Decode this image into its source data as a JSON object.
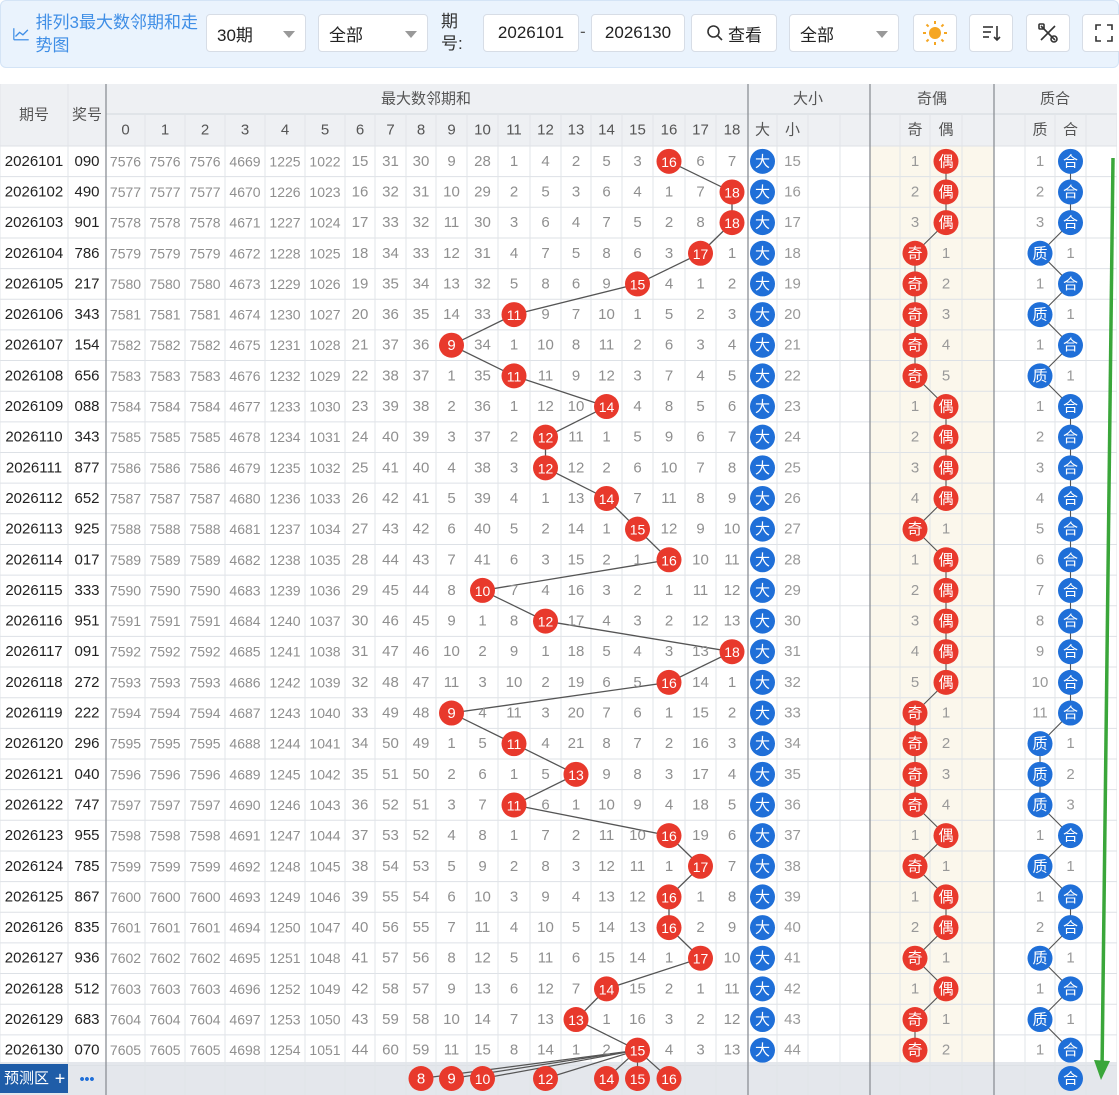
{
  "toolbar": {
    "title": "排列3最大数邻期和走势图",
    "period_select": "30期",
    "filter_select": "全部",
    "issue_label": "期号:",
    "issue_start": "2026101",
    "issue_sep": "-",
    "issue_end": "2026130",
    "query_label": "查看",
    "filter2_select": "全部",
    "icons": [
      "chart-line-icon",
      "search-icon",
      "sun-icon",
      "sort-icon",
      "tools-icon",
      "fullscreen-icon"
    ]
  },
  "headers": {
    "issue": "期号",
    "prize": "奖号",
    "main_group": "最大数邻期和",
    "size_group": "大小",
    "parity_group": "奇偶",
    "prime_group": "质合",
    "cols": [
      "0",
      "1",
      "2",
      "3",
      "4",
      "5",
      "6",
      "7",
      "8",
      "9",
      "10",
      "11",
      "12",
      "13",
      "14",
      "15",
      "16",
      "17",
      "18"
    ],
    "size_cols": [
      "大",
      "小"
    ],
    "parity_cols": [
      "奇",
      "偶"
    ],
    "prime_cols": [
      "质",
      "合"
    ]
  },
  "labels": {
    "big": "大",
    "small": "小",
    "odd": "奇",
    "even": "偶",
    "prime": "质",
    "composite": "合"
  },
  "colors": {
    "red": "#e8392c",
    "blue": "#1f6fd8",
    "line": "#555555",
    "arrow": "#3aa63a",
    "highlight": "#fbf7ec"
  },
  "rows": [
    {
      "issue": "2026101",
      "prize": "090",
      "cells": [
        "7576",
        "7576",
        "7576",
        "4669",
        "1225",
        "1022",
        "15",
        "31",
        "30",
        "9",
        "28",
        "1",
        "4",
        "2",
        "5",
        "3",
        "16",
        "6",
        "7"
      ],
      "hit": 16,
      "size": "big",
      "size_other": "15",
      "parity": "even",
      "parity_other": "1",
      "prime": "composite",
      "prime_other": "1"
    },
    {
      "issue": "2026102",
      "prize": "490",
      "cells": [
        "7577",
        "7577",
        "7577",
        "4670",
        "1226",
        "1023",
        "16",
        "32",
        "31",
        "10",
        "29",
        "2",
        "5",
        "3",
        "6",
        "4",
        "1",
        "7",
        "18"
      ],
      "hit": 18,
      "size": "big",
      "size_other": "16",
      "parity": "even",
      "parity_other": "2",
      "prime": "composite",
      "prime_other": "2"
    },
    {
      "issue": "2026103",
      "prize": "901",
      "cells": [
        "7578",
        "7578",
        "7578",
        "4671",
        "1227",
        "1024",
        "17",
        "33",
        "32",
        "11",
        "30",
        "3",
        "6",
        "4",
        "7",
        "5",
        "2",
        "8",
        "18"
      ],
      "hit": 18,
      "size": "big",
      "size_other": "17",
      "parity": "even",
      "parity_other": "3",
      "prime": "composite",
      "prime_other": "3"
    },
    {
      "issue": "2026104",
      "prize": "786",
      "cells": [
        "7579",
        "7579",
        "7579",
        "4672",
        "1228",
        "1025",
        "18",
        "34",
        "33",
        "12",
        "31",
        "4",
        "7",
        "5",
        "8",
        "6",
        "3",
        "17",
        "1"
      ],
      "hit": 17,
      "size": "big",
      "size_other": "18",
      "parity": "odd",
      "parity_other": "1",
      "prime": "prime",
      "prime_other": "1"
    },
    {
      "issue": "2026105",
      "prize": "217",
      "cells": [
        "7580",
        "7580",
        "7580",
        "4673",
        "1229",
        "1026",
        "19",
        "35",
        "34",
        "13",
        "32",
        "5",
        "8",
        "6",
        "9",
        "15",
        "4",
        "1",
        "2"
      ],
      "hit": 15,
      "size": "big",
      "size_other": "19",
      "parity": "odd",
      "parity_other": "2",
      "prime": "composite",
      "prime_other": "1"
    },
    {
      "issue": "2026106",
      "prize": "343",
      "cells": [
        "7581",
        "7581",
        "7581",
        "4674",
        "1230",
        "1027",
        "20",
        "36",
        "35",
        "14",
        "33",
        "11",
        "9",
        "7",
        "10",
        "1",
        "5",
        "2",
        "3"
      ],
      "hit": 11,
      "size": "big",
      "size_other": "20",
      "parity": "odd",
      "parity_other": "3",
      "prime": "prime",
      "prime_other": "1"
    },
    {
      "issue": "2026107",
      "prize": "154",
      "cells": [
        "7582",
        "7582",
        "7582",
        "4675",
        "1231",
        "1028",
        "21",
        "37",
        "36",
        "9",
        "34",
        "1",
        "10",
        "8",
        "11",
        "2",
        "6",
        "3",
        "4"
      ],
      "hit": 9,
      "size": "big",
      "size_other": "21",
      "parity": "odd",
      "parity_other": "4",
      "prime": "composite",
      "prime_other": "1"
    },
    {
      "issue": "2026108",
      "prize": "656",
      "cells": [
        "7583",
        "7583",
        "7583",
        "4676",
        "1232",
        "1029",
        "22",
        "38",
        "37",
        "1",
        "35",
        "11",
        "11",
        "9",
        "12",
        "3",
        "7",
        "4",
        "5"
      ],
      "hit": 11,
      "size": "big",
      "size_other": "22",
      "parity": "odd",
      "parity_other": "5",
      "prime": "prime",
      "prime_other": "1"
    },
    {
      "issue": "2026109",
      "prize": "088",
      "cells": [
        "7584",
        "7584",
        "7584",
        "4677",
        "1233",
        "1030",
        "23",
        "39",
        "38",
        "2",
        "36",
        "1",
        "12",
        "10",
        "14",
        "4",
        "8",
        "5",
        "6"
      ],
      "hit": 14,
      "size": "big",
      "size_other": "23",
      "parity": "even",
      "parity_other": "1",
      "prime": "composite",
      "prime_other": "1"
    },
    {
      "issue": "2026110",
      "prize": "343",
      "cells": [
        "7585",
        "7585",
        "7585",
        "4678",
        "1234",
        "1031",
        "24",
        "40",
        "39",
        "3",
        "37",
        "2",
        "12",
        "11",
        "1",
        "5",
        "9",
        "6",
        "7"
      ],
      "hit": 12,
      "size": "big",
      "size_other": "24",
      "parity": "even",
      "parity_other": "2",
      "prime": "composite",
      "prime_other": "2"
    },
    {
      "issue": "2026111",
      "prize": "877",
      "cells": [
        "7586",
        "7586",
        "7586",
        "4679",
        "1235",
        "1032",
        "25",
        "41",
        "40",
        "4",
        "38",
        "3",
        "12",
        "12",
        "2",
        "6",
        "10",
        "7",
        "8"
      ],
      "hit": 12,
      "size": "big",
      "size_other": "25",
      "parity": "even",
      "parity_other": "3",
      "prime": "composite",
      "prime_other": "3"
    },
    {
      "issue": "2026112",
      "prize": "652",
      "cells": [
        "7587",
        "7587",
        "7587",
        "4680",
        "1236",
        "1033",
        "26",
        "42",
        "41",
        "5",
        "39",
        "4",
        "1",
        "13",
        "14",
        "7",
        "11",
        "8",
        "9"
      ],
      "hit": 14,
      "size": "big",
      "size_other": "26",
      "parity": "even",
      "parity_other": "4",
      "prime": "composite",
      "prime_other": "4"
    },
    {
      "issue": "2026113",
      "prize": "925",
      "cells": [
        "7588",
        "7588",
        "7588",
        "4681",
        "1237",
        "1034",
        "27",
        "43",
        "42",
        "6",
        "40",
        "5",
        "2",
        "14",
        "1",
        "15",
        "12",
        "9",
        "10"
      ],
      "hit": 15,
      "size": "big",
      "size_other": "27",
      "parity": "odd",
      "parity_other": "1",
      "prime": "composite",
      "prime_other": "5"
    },
    {
      "issue": "2026114",
      "prize": "017",
      "cells": [
        "7589",
        "7589",
        "7589",
        "4682",
        "1238",
        "1035",
        "28",
        "44",
        "43",
        "7",
        "41",
        "6",
        "3",
        "15",
        "2",
        "1",
        "16",
        "10",
        "11"
      ],
      "hit": 16,
      "size": "big",
      "size_other": "28",
      "parity": "even",
      "parity_other": "1",
      "prime": "composite",
      "prime_other": "6"
    },
    {
      "issue": "2026115",
      "prize": "333",
      "cells": [
        "7590",
        "7590",
        "7590",
        "4683",
        "1239",
        "1036",
        "29",
        "45",
        "44",
        "8",
        "10",
        "7",
        "4",
        "16",
        "3",
        "2",
        "1",
        "11",
        "12"
      ],
      "hit": 10,
      "size": "big",
      "size_other": "29",
      "parity": "even",
      "parity_other": "2",
      "prime": "composite",
      "prime_other": "7"
    },
    {
      "issue": "2026116",
      "prize": "951",
      "cells": [
        "7591",
        "7591",
        "7591",
        "4684",
        "1240",
        "1037",
        "30",
        "46",
        "45",
        "9",
        "1",
        "8",
        "12",
        "17",
        "4",
        "3",
        "2",
        "12",
        "13"
      ],
      "hit": 12,
      "size": "big",
      "size_other": "30",
      "parity": "even",
      "parity_other": "3",
      "prime": "composite",
      "prime_other": "8"
    },
    {
      "issue": "2026117",
      "prize": "091",
      "cells": [
        "7592",
        "7592",
        "7592",
        "4685",
        "1241",
        "1038",
        "31",
        "47",
        "46",
        "10",
        "2",
        "9",
        "1",
        "18",
        "5",
        "4",
        "3",
        "13",
        "18"
      ],
      "hit": 18,
      "size": "big",
      "size_other": "31",
      "parity": "even",
      "parity_other": "4",
      "prime": "composite",
      "prime_other": "9"
    },
    {
      "issue": "2026118",
      "prize": "272",
      "cells": [
        "7593",
        "7593",
        "7593",
        "4686",
        "1242",
        "1039",
        "32",
        "48",
        "47",
        "11",
        "3",
        "10",
        "2",
        "19",
        "6",
        "5",
        "16",
        "14",
        "1"
      ],
      "hit": 16,
      "size": "big",
      "size_other": "32",
      "parity": "even",
      "parity_other": "5",
      "prime": "composite",
      "prime_other": "10"
    },
    {
      "issue": "2026119",
      "prize": "222",
      "cells": [
        "7594",
        "7594",
        "7594",
        "4687",
        "1243",
        "1040",
        "33",
        "49",
        "48",
        "9",
        "4",
        "11",
        "3",
        "20",
        "7",
        "6",
        "1",
        "15",
        "2"
      ],
      "hit": 9,
      "size": "big",
      "size_other": "33",
      "parity": "odd",
      "parity_other": "1",
      "prime": "composite",
      "prime_other": "11"
    },
    {
      "issue": "2026120",
      "prize": "296",
      "cells": [
        "7595",
        "7595",
        "7595",
        "4688",
        "1244",
        "1041",
        "34",
        "50",
        "49",
        "1",
        "5",
        "11",
        "4",
        "21",
        "8",
        "7",
        "2",
        "16",
        "3"
      ],
      "hit": 11,
      "size": "big",
      "size_other": "34",
      "parity": "odd",
      "parity_other": "2",
      "prime": "prime",
      "prime_other": "1"
    },
    {
      "issue": "2026121",
      "prize": "040",
      "cells": [
        "7596",
        "7596",
        "7596",
        "4689",
        "1245",
        "1042",
        "35",
        "51",
        "50",
        "2",
        "6",
        "1",
        "5",
        "13",
        "9",
        "8",
        "3",
        "17",
        "4"
      ],
      "hit": 13,
      "size": "big",
      "size_other": "35",
      "parity": "odd",
      "parity_other": "3",
      "prime": "prime",
      "prime_other": "2"
    },
    {
      "issue": "2026122",
      "prize": "747",
      "cells": [
        "7597",
        "7597",
        "7597",
        "4690",
        "1246",
        "1043",
        "36",
        "52",
        "51",
        "3",
        "7",
        "11",
        "6",
        "1",
        "10",
        "9",
        "4",
        "18",
        "5"
      ],
      "hit": 11,
      "size": "big",
      "size_other": "36",
      "parity": "odd",
      "parity_other": "4",
      "prime": "prime",
      "prime_other": "3"
    },
    {
      "issue": "2026123",
      "prize": "955",
      "cells": [
        "7598",
        "7598",
        "7598",
        "4691",
        "1247",
        "1044",
        "37",
        "53",
        "52",
        "4",
        "8",
        "1",
        "7",
        "2",
        "11",
        "10",
        "16",
        "19",
        "6"
      ],
      "hit": 16,
      "size": "big",
      "size_other": "37",
      "parity": "even",
      "parity_other": "1",
      "prime": "composite",
      "prime_other": "1"
    },
    {
      "issue": "2026124",
      "prize": "785",
      "cells": [
        "7599",
        "7599",
        "7599",
        "4692",
        "1248",
        "1045",
        "38",
        "54",
        "53",
        "5",
        "9",
        "2",
        "8",
        "3",
        "12",
        "11",
        "1",
        "17",
        "7"
      ],
      "hit": 17,
      "size": "big",
      "size_other": "38",
      "parity": "odd",
      "parity_other": "1",
      "prime": "prime",
      "prime_other": "1"
    },
    {
      "issue": "2026125",
      "prize": "867",
      "cells": [
        "7600",
        "7600",
        "7600",
        "4693",
        "1249",
        "1046",
        "39",
        "55",
        "54",
        "6",
        "10",
        "3",
        "9",
        "4",
        "13",
        "12",
        "16",
        "1",
        "8"
      ],
      "hit": 16,
      "size": "big",
      "size_other": "39",
      "parity": "even",
      "parity_other": "1",
      "prime": "composite",
      "prime_other": "1"
    },
    {
      "issue": "2026126",
      "prize": "835",
      "cells": [
        "7601",
        "7601",
        "7601",
        "4694",
        "1250",
        "1047",
        "40",
        "56",
        "55",
        "7",
        "11",
        "4",
        "10",
        "5",
        "14",
        "13",
        "16",
        "2",
        "9"
      ],
      "hit": 16,
      "size": "big",
      "size_other": "40",
      "parity": "even",
      "parity_other": "2",
      "prime": "composite",
      "prime_other": "2"
    },
    {
      "issue": "2026127",
      "prize": "936",
      "cells": [
        "7602",
        "7602",
        "7602",
        "4695",
        "1251",
        "1048",
        "41",
        "57",
        "56",
        "8",
        "12",
        "5",
        "11",
        "6",
        "15",
        "14",
        "1",
        "17",
        "10"
      ],
      "hit": 17,
      "size": "big",
      "size_other": "41",
      "parity": "odd",
      "parity_other": "1",
      "prime": "prime",
      "prime_other": "1"
    },
    {
      "issue": "2026128",
      "prize": "512",
      "cells": [
        "7603",
        "7603",
        "7603",
        "4696",
        "1252",
        "1049",
        "42",
        "58",
        "57",
        "9",
        "13",
        "6",
        "12",
        "7",
        "14",
        "15",
        "2",
        "1",
        "11"
      ],
      "hit": 14,
      "size": "big",
      "size_other": "42",
      "parity": "even",
      "parity_other": "1",
      "prime": "composite",
      "prime_other": "1"
    },
    {
      "issue": "2026129",
      "prize": "683",
      "cells": [
        "7604",
        "7604",
        "7604",
        "4697",
        "1253",
        "1050",
        "43",
        "59",
        "58",
        "10",
        "14",
        "7",
        "13",
        "13",
        "1",
        "16",
        "3",
        "2",
        "12"
      ],
      "hit": 13,
      "size": "big",
      "size_other": "43",
      "parity": "odd",
      "parity_other": "1",
      "prime": "prime",
      "prime_other": "1"
    },
    {
      "issue": "2026130",
      "prize": "070",
      "cells": [
        "7605",
        "7605",
        "7605",
        "4698",
        "1254",
        "1051",
        "44",
        "60",
        "59",
        "11",
        "15",
        "8",
        "14",
        "1",
        "2",
        "15",
        "4",
        "3",
        "13"
      ],
      "hit": 15,
      "size": "big",
      "size_other": "44",
      "parity": "odd",
      "parity_other": "2",
      "prime": "composite",
      "prime_other": "1"
    }
  ],
  "predict": {
    "label": "预测区",
    "plus": "+",
    "more": "•••",
    "balls": [
      8,
      9,
      10,
      12,
      14,
      15,
      16
    ],
    "prime_ball": "composite"
  }
}
